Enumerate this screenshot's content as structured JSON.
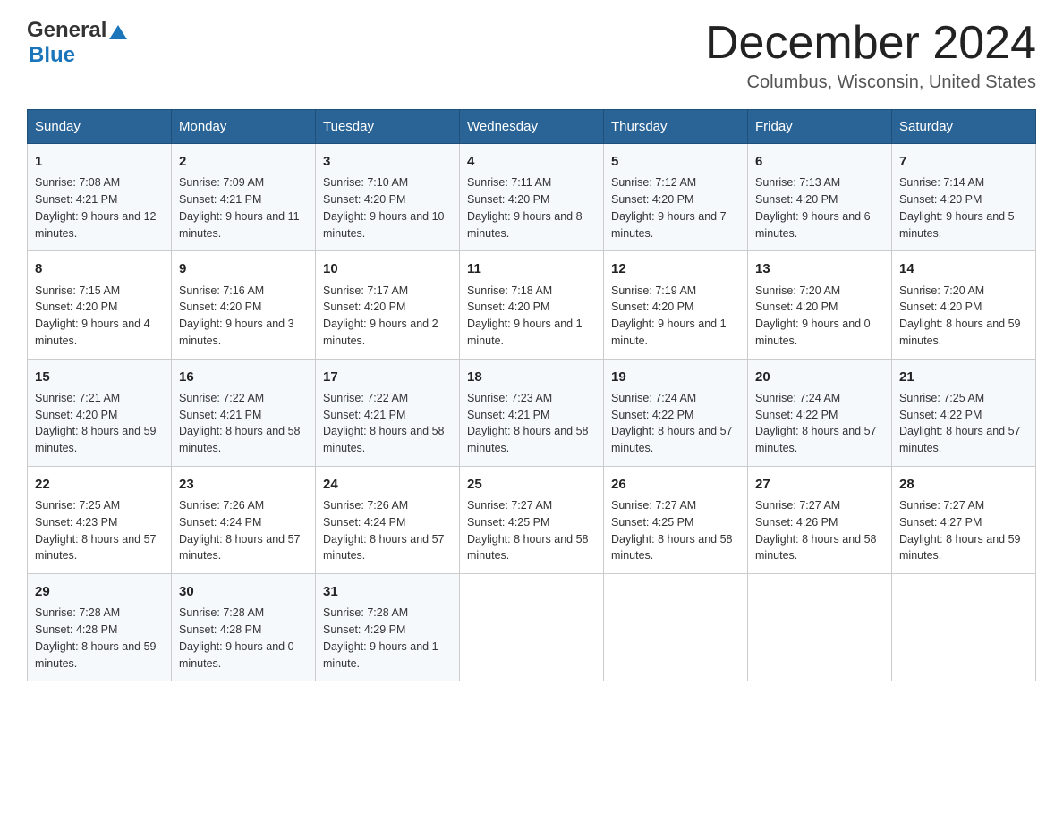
{
  "header": {
    "logo_line1": "General",
    "logo_line2": "Blue",
    "month_title": "December 2024",
    "location": "Columbus, Wisconsin, United States"
  },
  "days_of_week": [
    "Sunday",
    "Monday",
    "Tuesday",
    "Wednesday",
    "Thursday",
    "Friday",
    "Saturday"
  ],
  "weeks": [
    [
      {
        "day": "1",
        "sunrise": "7:08 AM",
        "sunset": "4:21 PM",
        "daylight": "9 hours and 12 minutes."
      },
      {
        "day": "2",
        "sunrise": "7:09 AM",
        "sunset": "4:21 PM",
        "daylight": "9 hours and 11 minutes."
      },
      {
        "day": "3",
        "sunrise": "7:10 AM",
        "sunset": "4:20 PM",
        "daylight": "9 hours and 10 minutes."
      },
      {
        "day": "4",
        "sunrise": "7:11 AM",
        "sunset": "4:20 PM",
        "daylight": "9 hours and 8 minutes."
      },
      {
        "day": "5",
        "sunrise": "7:12 AM",
        "sunset": "4:20 PM",
        "daylight": "9 hours and 7 minutes."
      },
      {
        "day": "6",
        "sunrise": "7:13 AM",
        "sunset": "4:20 PM",
        "daylight": "9 hours and 6 minutes."
      },
      {
        "day": "7",
        "sunrise": "7:14 AM",
        "sunset": "4:20 PM",
        "daylight": "9 hours and 5 minutes."
      }
    ],
    [
      {
        "day": "8",
        "sunrise": "7:15 AM",
        "sunset": "4:20 PM",
        "daylight": "9 hours and 4 minutes."
      },
      {
        "day": "9",
        "sunrise": "7:16 AM",
        "sunset": "4:20 PM",
        "daylight": "9 hours and 3 minutes."
      },
      {
        "day": "10",
        "sunrise": "7:17 AM",
        "sunset": "4:20 PM",
        "daylight": "9 hours and 2 minutes."
      },
      {
        "day": "11",
        "sunrise": "7:18 AM",
        "sunset": "4:20 PM",
        "daylight": "9 hours and 1 minute."
      },
      {
        "day": "12",
        "sunrise": "7:19 AM",
        "sunset": "4:20 PM",
        "daylight": "9 hours and 1 minute."
      },
      {
        "day": "13",
        "sunrise": "7:20 AM",
        "sunset": "4:20 PM",
        "daylight": "9 hours and 0 minutes."
      },
      {
        "day": "14",
        "sunrise": "7:20 AM",
        "sunset": "4:20 PM",
        "daylight": "8 hours and 59 minutes."
      }
    ],
    [
      {
        "day": "15",
        "sunrise": "7:21 AM",
        "sunset": "4:20 PM",
        "daylight": "8 hours and 59 minutes."
      },
      {
        "day": "16",
        "sunrise": "7:22 AM",
        "sunset": "4:21 PM",
        "daylight": "8 hours and 58 minutes."
      },
      {
        "day": "17",
        "sunrise": "7:22 AM",
        "sunset": "4:21 PM",
        "daylight": "8 hours and 58 minutes."
      },
      {
        "day": "18",
        "sunrise": "7:23 AM",
        "sunset": "4:21 PM",
        "daylight": "8 hours and 58 minutes."
      },
      {
        "day": "19",
        "sunrise": "7:24 AM",
        "sunset": "4:22 PM",
        "daylight": "8 hours and 57 minutes."
      },
      {
        "day": "20",
        "sunrise": "7:24 AM",
        "sunset": "4:22 PM",
        "daylight": "8 hours and 57 minutes."
      },
      {
        "day": "21",
        "sunrise": "7:25 AM",
        "sunset": "4:22 PM",
        "daylight": "8 hours and 57 minutes."
      }
    ],
    [
      {
        "day": "22",
        "sunrise": "7:25 AM",
        "sunset": "4:23 PM",
        "daylight": "8 hours and 57 minutes."
      },
      {
        "day": "23",
        "sunrise": "7:26 AM",
        "sunset": "4:24 PM",
        "daylight": "8 hours and 57 minutes."
      },
      {
        "day": "24",
        "sunrise": "7:26 AM",
        "sunset": "4:24 PM",
        "daylight": "8 hours and 57 minutes."
      },
      {
        "day": "25",
        "sunrise": "7:27 AM",
        "sunset": "4:25 PM",
        "daylight": "8 hours and 58 minutes."
      },
      {
        "day": "26",
        "sunrise": "7:27 AM",
        "sunset": "4:25 PM",
        "daylight": "8 hours and 58 minutes."
      },
      {
        "day": "27",
        "sunrise": "7:27 AM",
        "sunset": "4:26 PM",
        "daylight": "8 hours and 58 minutes."
      },
      {
        "day": "28",
        "sunrise": "7:27 AM",
        "sunset": "4:27 PM",
        "daylight": "8 hours and 59 minutes."
      }
    ],
    [
      {
        "day": "29",
        "sunrise": "7:28 AM",
        "sunset": "4:28 PM",
        "daylight": "8 hours and 59 minutes."
      },
      {
        "day": "30",
        "sunrise": "7:28 AM",
        "sunset": "4:28 PM",
        "daylight": "9 hours and 0 minutes."
      },
      {
        "day": "31",
        "sunrise": "7:28 AM",
        "sunset": "4:29 PM",
        "daylight": "9 hours and 1 minute."
      },
      null,
      null,
      null,
      null
    ]
  ],
  "labels": {
    "sunrise": "Sunrise:",
    "sunset": "Sunset:",
    "daylight": "Daylight:"
  }
}
